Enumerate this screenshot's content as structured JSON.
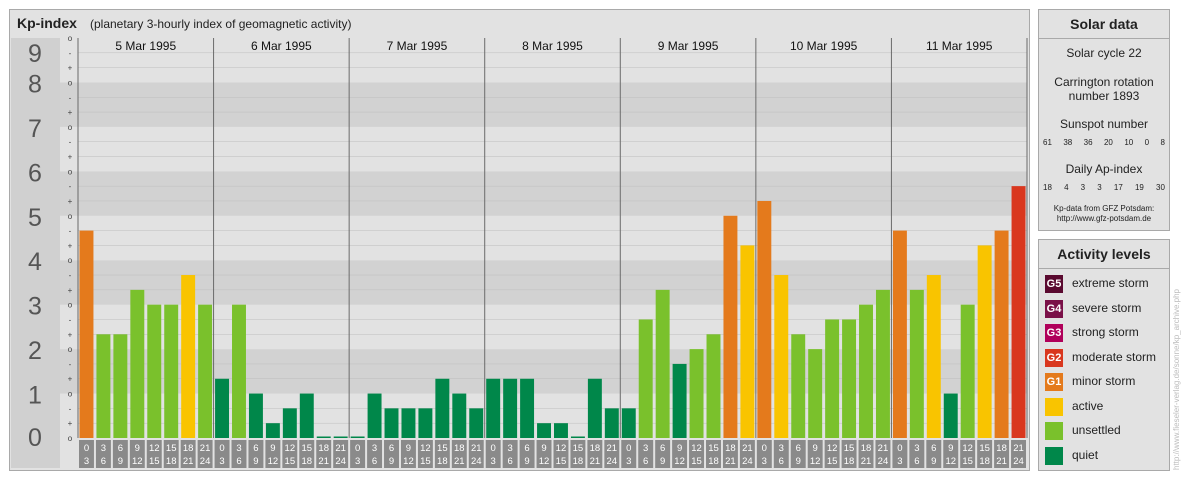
{
  "header": {
    "title": "Kp-index",
    "subtitle": "(planetary 3-hourly index of geomagnetic activity)"
  },
  "chart_data": {
    "type": "bar",
    "title": "Kp-index",
    "subtitle": "(planetary 3-hourly index of geomagnetic activity)",
    "ylim": [
      0,
      9
    ],
    "y_ticks": [
      "0",
      "1",
      "2",
      "3",
      "4",
      "5",
      "6",
      "7",
      "8",
      "9"
    ],
    "sub_ticks": [
      "-",
      "o",
      "+"
    ],
    "days": [
      "5 Mar 1995",
      "6 Mar 1995",
      "7 Mar 1995",
      "8 Mar 1995",
      "9 Mar 1995",
      "10 Mar 1995",
      "11 Mar 1995"
    ],
    "slot_start_hours": [
      "0",
      "3",
      "6",
      "9",
      "12",
      "15",
      "18",
      "21"
    ],
    "slot_end_hours": [
      "3",
      "6",
      "9",
      "12",
      "15",
      "18",
      "21",
      "24"
    ],
    "values": [
      [
        4.667,
        2.333,
        2.333,
        3.333,
        3.0,
        3.0,
        3.667,
        3.0
      ],
      [
        1.333,
        3.0,
        1.0,
        0.333,
        0.667,
        1.0,
        0.0,
        0.0
      ],
      [
        0.0,
        1.0,
        0.667,
        0.667,
        0.667,
        1.333,
        1.0,
        0.667
      ],
      [
        1.333,
        1.333,
        1.333,
        0.333,
        0.333,
        0.0,
        1.333,
        0.667
      ],
      [
        0.667,
        2.667,
        3.333,
        1.667,
        2.0,
        2.333,
        5.0,
        4.333
      ],
      [
        5.333,
        3.667,
        2.333,
        2.0,
        2.667,
        2.667,
        3.0,
        3.333
      ],
      [
        4.667,
        3.333,
        3.667,
        1.0,
        3.0,
        4.333,
        4.667,
        5.667
      ]
    ],
    "grid": "horizontal",
    "legend_placement": "right"
  },
  "solar": {
    "title": "Solar data",
    "cycle": "Solar cycle 22",
    "carrington_line1": "Carrington rotation",
    "carrington_line2": "number 1893",
    "sunspot_title": "Sunspot number",
    "sunspot_values": [
      "61",
      "38",
      "36",
      "20",
      "10",
      "0",
      "8"
    ],
    "ap_title": "Daily Ap-index",
    "ap_values": [
      "18",
      "4",
      "3",
      "3",
      "17",
      "19",
      "30"
    ],
    "source_line1": "Kp-data from GFZ Potsdam:",
    "source_line2": "http://www.gfz-potsdam.de"
  },
  "activity": {
    "title": "Activity levels",
    "items": [
      {
        "badge": "G5",
        "label": "extreme storm",
        "color": "#5a0a30"
      },
      {
        "badge": "G4",
        "label": "severe storm",
        "color": "#7a1048"
      },
      {
        "badge": "G3",
        "label": "strong storm",
        "color": "#b0005a"
      },
      {
        "badge": "G2",
        "label": "moderate storm",
        "color": "#d9371e"
      },
      {
        "badge": "G1",
        "label": "minor storm",
        "color": "#e47a1c"
      },
      {
        "badge": "",
        "label": "active",
        "color": "#f9c400"
      },
      {
        "badge": "",
        "label": "unsettled",
        "color": "#7ac12c"
      },
      {
        "badge": "",
        "label": "quiet",
        "color": "#00874a"
      }
    ]
  },
  "credit": "http://www.fieseler-verlag.de/sonne/kp_archive.php"
}
